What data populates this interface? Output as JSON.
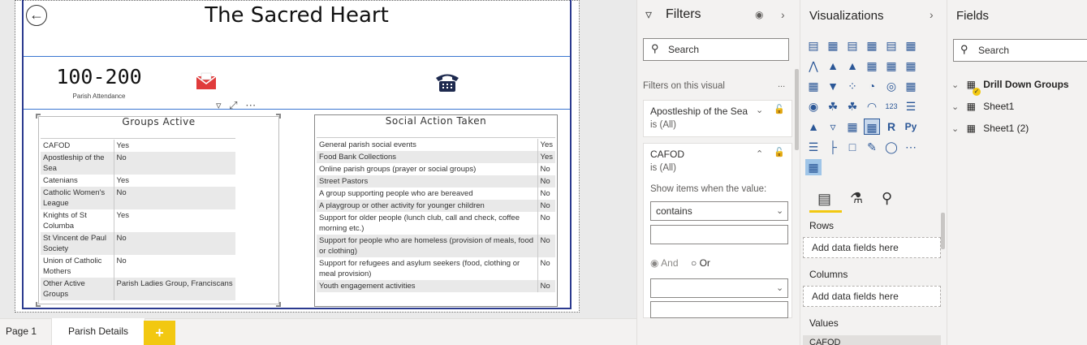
{
  "report": {
    "title": "The Sacred Heart",
    "kpi_value": "100-200",
    "kpi_label": "Parish Attendance"
  },
  "groups_visual": {
    "title": "Groups Active",
    "rows": [
      {
        "name": "CAFOD",
        "value": "Yes"
      },
      {
        "name": "Apostleship of the Sea",
        "value": "No"
      },
      {
        "name": "Catenians",
        "value": "Yes"
      },
      {
        "name": "Catholic Women's League",
        "value": "No"
      },
      {
        "name": "Knights of St Columba",
        "value": "Yes"
      },
      {
        "name": "St Vincent de Paul Society",
        "value": "No"
      },
      {
        "name": "Union of Catholic Mothers",
        "value": "No"
      },
      {
        "name": "Other Active Groups",
        "value": "Parish Ladies Group, Franciscans"
      }
    ]
  },
  "social_visual": {
    "title": "Social Action Taken",
    "rows": [
      {
        "name": "General parish social events",
        "value": "Yes"
      },
      {
        "name": "Food Bank Collections",
        "value": "Yes"
      },
      {
        "name": "Online parish groups (prayer or social groups)",
        "value": "No"
      },
      {
        "name": "Street Pastors",
        "value": "No"
      },
      {
        "name": "A group supporting people who are bereaved",
        "value": "No"
      },
      {
        "name": "A playgroup or other activity for younger children",
        "value": "No"
      },
      {
        "name": "Support for older people (lunch club, call and check, coffee morning etc.)",
        "value": "No"
      },
      {
        "name": "Support for people who are homeless (provision of meals, food or clothing)",
        "value": "No"
      },
      {
        "name": "Support for refugees and asylum seekers (food, clothing or meal provision)",
        "value": "No"
      },
      {
        "name": "Youth engagement activities",
        "value": "No"
      }
    ]
  },
  "tabs": {
    "tab1": "Page 1",
    "tab2": "Parish Details",
    "add": "+"
  },
  "filters": {
    "title": "Filters",
    "search_placeholder": "Search",
    "section_label": "Filters on this visual",
    "more": "...",
    "card1_title": "Apostleship of the Sea",
    "card1_value": "is (All)",
    "card2_title": "CAFOD",
    "card2_value": "is (All)",
    "show_items_label": "Show items when the value:",
    "condition": "contains",
    "and_label": "And",
    "or_label": "Or"
  },
  "visualizations": {
    "title": "Visualizations",
    "rows_label": "Rows",
    "rows_drop": "Add data fields here",
    "columns_label": "Columns",
    "columns_drop": "Add data fields here",
    "values_label": "Values",
    "values_chip": "CAFOD"
  },
  "fields": {
    "title": "Fields",
    "search_placeholder": "Search",
    "tables": [
      "Drill Down Groups",
      "Sheet1",
      "Sheet1 (2)"
    ]
  },
  "colors": {
    "frame": "#2b3a8f",
    "line": "#3a76d1",
    "accent": "#f2c811"
  }
}
